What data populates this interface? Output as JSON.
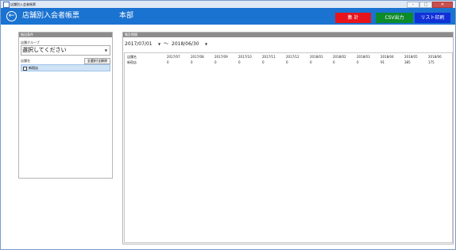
{
  "window": {
    "title": "店舗別入会者帳票",
    "minimize": "–",
    "maximize": "□",
    "close": "✕"
  },
  "header": {
    "back_icon": "back-arrow-icon",
    "back_glyph": "←",
    "title": "店舗別入会者帳票",
    "store": "本部",
    "buttons": {
      "aggregate": "集 計",
      "csv": "CSV出力",
      "print": "リスト印刷"
    },
    "colors": {
      "bar": "#1b73d1",
      "aggregate": "#e8131b",
      "csv": "#0d8a2a",
      "print": "#1230d8"
    }
  },
  "conditions": {
    "panel_title": "抽出条件",
    "group_label": "店舗グループ",
    "group_select": "選択してください",
    "store_label": "店舗名",
    "toggle_all": "全選択/全解除",
    "stores": [
      "新宿店"
    ]
  },
  "period": {
    "panel_title": "集計期間",
    "from": "2017/07/01",
    "separator": "～",
    "to": "2018/06/30"
  },
  "table": {
    "header": [
      "店舗名",
      "2017/07",
      "2017/08",
      "2017/09",
      "2017/10",
      "2017/11",
      "2017/12",
      "2018/01",
      "2018/02",
      "2018/03",
      "2018/04",
      "2018/05",
      "2018/06"
    ],
    "rows": [
      [
        "新宿店",
        "0",
        "0",
        "0",
        "0",
        "0",
        "0",
        "0",
        "0",
        "0",
        "91",
        "385",
        "175"
      ]
    ]
  }
}
